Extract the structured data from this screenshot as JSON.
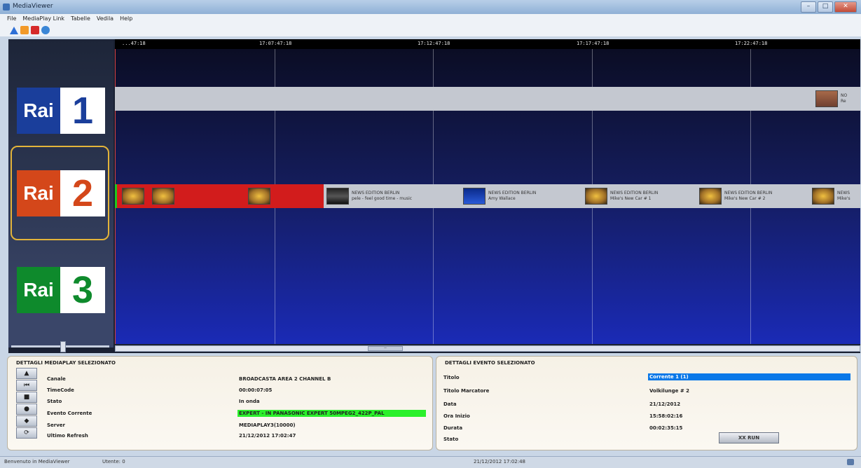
{
  "window": {
    "title": "MediaViewer"
  },
  "menu": [
    "File",
    "MediaPlay Link",
    "Tabelle",
    "Vedila",
    "Help"
  ],
  "toolbar": {
    "icons": [
      "triangle-icon",
      "orange-icon",
      "red-icon",
      "gear-icon"
    ]
  },
  "colors": {
    "rai1": "#1a3e9b",
    "rai2": "#d4471a",
    "rai3": "#0e8a2c",
    "rai1_num": "#1a3e9b",
    "rai2_num": "#d4471a",
    "rai3_num": "#0e8a2c",
    "playing_red": "#d21c1c",
    "current_green": "#2bf02b",
    "selected_blue": "#0a78e8"
  },
  "channels": [
    {
      "name": "Rai",
      "number": "1"
    },
    {
      "name": "Rai",
      "number": "2"
    },
    {
      "name": "Rai",
      "number": "3"
    }
  ],
  "ruler": [
    "...47:18",
    "17:07:47:18",
    "17:12:47:18",
    "17:17:47:18",
    "17:22:47:18"
  ],
  "events": [
    {
      "title": "",
      "subtitle": ""
    },
    {
      "title": "",
      "subtitle": ""
    },
    {
      "title": "",
      "subtitle": ""
    },
    {
      "title": "NEWS EDITION BERLIN",
      "subtitle": "pele - feel good time - music"
    },
    {
      "title": "NEWS EDITION BERLIN",
      "subtitle": "Amy Wallace"
    },
    {
      "title": "NEWS EDITION BERLIN",
      "subtitle": "Mike's New Car # 1"
    },
    {
      "title": "NEWS EDITION BERLIN",
      "subtitle": "Mike's New Car # 2"
    },
    {
      "title": "NEWS",
      "subtitle": "Mike's"
    }
  ],
  "rai1_event": {
    "title": "NO",
    "subtitle": "Re"
  },
  "left_panel": {
    "title": "DETTAGLI MEDIAPLAY SELEZIONATO",
    "labels": [
      "Canale",
      "TimeCode",
      "Stato",
      "Evento Corrente",
      "Server",
      "Ultimo Refresh"
    ],
    "values": [
      "BROADCASTA AREA 2 CHANNEL B",
      "00:00:07:05",
      "In onda",
      "EXPERT - IN PANASONIC EXPERT 50MPEG2_422P_PAL",
      "MEDIAPLAY3(10000)",
      "21/12/2012 17:02:47"
    ]
  },
  "right_panel": {
    "title": "DETTAGLI EVENTO SELEZIONATO",
    "labels": [
      "Titolo",
      "Titolo Marcatore",
      "Data",
      "Ora Inizio",
      "Durata",
      "Stato"
    ],
    "values": [
      "Corrente 1 (1)",
      "Volkilunge # 2",
      "21/12/2012",
      "15:58:02:16",
      "00:02:35:15",
      ""
    ],
    "button": "XX RUN"
  },
  "statusbar": {
    "welcome": "Benvenuto in MediaViewer",
    "user": "Utente: 0",
    "datetime": "21/12/2012 17:02:48"
  }
}
